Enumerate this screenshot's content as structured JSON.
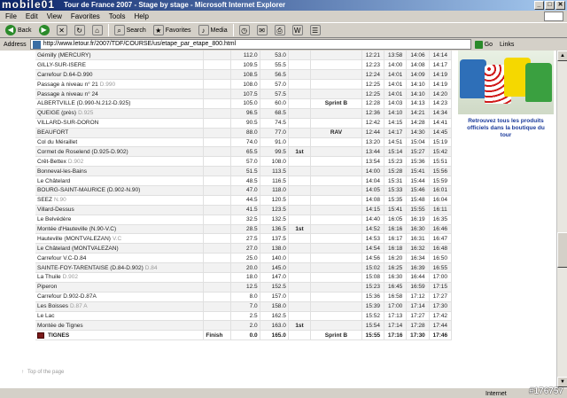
{
  "window": {
    "watermark": "mobile01",
    "title": "Tour de France 2007 - Stage by stage - Microsoft Internet Explorer",
    "min": "_",
    "max": "□",
    "close": "✕"
  },
  "menu": [
    "File",
    "Edit",
    "View",
    "Favorites",
    "Tools",
    "Help"
  ],
  "toolbar": {
    "back": "Back",
    "search": "Search",
    "favorites": "Favorites",
    "media": "Media"
  },
  "address": {
    "label": "Address",
    "url": "http://www.letour.fr/2007/TDF/COURSE/us/etape_par_etape_800.html",
    "go": "Go",
    "links": "Links"
  },
  "rows": [
    {
      "loc": "Gémilly (MERCURY)",
      "sub": "",
      "km1": "112.0",
      "km2": "53.0",
      "mark": "",
      "sprint": "",
      "t1": "12:21",
      "t2": "13:58",
      "t3": "14:06",
      "t4": "14:14"
    },
    {
      "loc": "GILLY-SUR-ISERE",
      "sub": "",
      "km1": "109.5",
      "km2": "55.5",
      "mark": "",
      "sprint": "",
      "t1": "12:23",
      "t2": "14:00",
      "t3": "14:08",
      "t4": "14:17"
    },
    {
      "loc": "Carrefour D.64-D.990",
      "sub": "",
      "km1": "108.5",
      "km2": "56.5",
      "mark": "",
      "sprint": "",
      "t1": "12:24",
      "t2": "14:01",
      "t3": "14:09",
      "t4": "14:19"
    },
    {
      "loc": "Passage à niveau n° 21",
      "sub": "D.990",
      "km1": "108.0",
      "km2": "57.0",
      "mark": "",
      "sprint": "",
      "t1": "12:25",
      "t2": "14:01",
      "t3": "14:10",
      "t4": "14:19"
    },
    {
      "loc": "Passage à niveau n° 24",
      "sub": "",
      "km1": "107.5",
      "km2": "57.5",
      "mark": "",
      "sprint": "",
      "t1": "12:25",
      "t2": "14:01",
      "t3": "14:10",
      "t4": "14:20"
    },
    {
      "loc": "ALBERTVILLE (D.990-N.212-D.925)",
      "sub": "",
      "km1": "105.0",
      "km2": "60.0",
      "mark": "",
      "sprint": "Sprint B",
      "t1": "12:28",
      "t2": "14:03",
      "t3": "14:13",
      "t4": "14:23"
    },
    {
      "loc": "QUEIGE (près)",
      "sub": "D.925",
      "km1": "96.5",
      "km2": "68.5",
      "mark": "",
      "sprint": "",
      "t1": "12:36",
      "t2": "14:10",
      "t3": "14:21",
      "t4": "14:34"
    },
    {
      "loc": "VILLARD-SUR-DORON",
      "sub": "",
      "km1": "90.5",
      "km2": "74.5",
      "mark": "",
      "sprint": "",
      "t1": "12:42",
      "t2": "14:15",
      "t3": "14:28",
      "t4": "14:41"
    },
    {
      "loc": "BEAUFORT",
      "sub": "",
      "km1": "88.0",
      "km2": "77.0",
      "mark": "",
      "sprint": "RAV",
      "t1": "12:44",
      "t2": "14:17",
      "t3": "14:30",
      "t4": "14:45"
    },
    {
      "loc": "Col du Méraillet",
      "sub": "",
      "km1": "74.0",
      "km2": "91.0",
      "mark": "",
      "sprint": "",
      "t1": "13:20",
      "t2": "14:51",
      "t3": "15:04",
      "t4": "15:19"
    },
    {
      "loc": "Cormet de Roselend (D.925-D.902)",
      "sub": "",
      "km1": "65.5",
      "km2": "99.5",
      "mark": "1st",
      "sprint": "",
      "t1": "13:44",
      "t2": "15:14",
      "t3": "15:27",
      "t4": "15:42"
    },
    {
      "loc": "Crêt-Bettex",
      "sub": "D.902",
      "km1": "57.0",
      "km2": "108.0",
      "mark": "",
      "sprint": "",
      "t1": "13:54",
      "t2": "15:23",
      "t3": "15:36",
      "t4": "15:51"
    },
    {
      "loc": "Bonneval-les-Bains",
      "sub": "",
      "km1": "51.5",
      "km2": "113.5",
      "mark": "",
      "sprint": "",
      "t1": "14:00",
      "t2": "15:28",
      "t3": "15:41",
      "t4": "15:56"
    },
    {
      "loc": "Le Châtelard",
      "sub": "",
      "km1": "48.5",
      "km2": "116.5",
      "mark": "",
      "sprint": "",
      "t1": "14:04",
      "t2": "15:31",
      "t3": "15:44",
      "t4": "15:59"
    },
    {
      "loc": "BOURG-SAINT-MAURICE (D.902-N.90)",
      "sub": "",
      "km1": "47.0",
      "km2": "118.0",
      "mark": "",
      "sprint": "",
      "t1": "14:05",
      "t2": "15:33",
      "t3": "15:46",
      "t4": "16:01"
    },
    {
      "loc": "SEEZ",
      "sub": "N.90",
      "km1": "44.5",
      "km2": "120.5",
      "mark": "",
      "sprint": "",
      "t1": "14:08",
      "t2": "15:35",
      "t3": "15:48",
      "t4": "16:04"
    },
    {
      "loc": "Villard-Dessus",
      "sub": "",
      "km1": "41.5",
      "km2": "123.5",
      "mark": "",
      "sprint": "",
      "t1": "14:15",
      "t2": "15:41",
      "t3": "15:55",
      "t4": "16:11"
    },
    {
      "loc": "Le Belvédère",
      "sub": "",
      "km1": "32.5",
      "km2": "132.5",
      "mark": "",
      "sprint": "",
      "t1": "14:40",
      "t2": "16:05",
      "t3": "16:19",
      "t4": "16:35"
    },
    {
      "loc": "Montée d'Hauteville (N.90-V.C)",
      "sub": "",
      "km1": "28.5",
      "km2": "136.5",
      "mark": "1st",
      "sprint": "",
      "t1": "14:52",
      "t2": "16:16",
      "t3": "16:30",
      "t4": "16:46"
    },
    {
      "loc": "Hauteville (MONTVALEZAN)",
      "sub": "V.C",
      "km1": "27.5",
      "km2": "137.5",
      "mark": "",
      "sprint": "",
      "t1": "14:53",
      "t2": "16:17",
      "t3": "16:31",
      "t4": "16:47"
    },
    {
      "loc": "Le Châtelard (MONTVALEZAN)",
      "sub": "",
      "km1": "27.0",
      "km2": "138.0",
      "mark": "",
      "sprint": "",
      "t1": "14:54",
      "t2": "16:18",
      "t3": "16:32",
      "t4": "16:48"
    },
    {
      "loc": "Carrefour V.C-D.84",
      "sub": "",
      "km1": "25.0",
      "km2": "140.0",
      "mark": "",
      "sprint": "",
      "t1": "14:56",
      "t2": "16:20",
      "t3": "16:34",
      "t4": "16:50"
    },
    {
      "loc": "SAINTE-FOY-TARENTAISE (D.84-D.902)",
      "sub": "D.84",
      "km1": "20.0",
      "km2": "145.0",
      "mark": "",
      "sprint": "",
      "t1": "15:02",
      "t2": "16:25",
      "t3": "16:39",
      "t4": "16:55"
    },
    {
      "loc": "La Thuile",
      "sub": "D.902",
      "km1": "18.0",
      "km2": "147.0",
      "mark": "",
      "sprint": "",
      "t1": "15:08",
      "t2": "16:30",
      "t3": "16:44",
      "t4": "17:00"
    },
    {
      "loc": "Piperon",
      "sub": "",
      "km1": "12.5",
      "km2": "152.5",
      "mark": "",
      "sprint": "",
      "t1": "15:23",
      "t2": "16:45",
      "t3": "16:59",
      "t4": "17:15"
    },
    {
      "loc": "Carrefour D.902-D.87A",
      "sub": "",
      "km1": "8.0",
      "km2": "157.0",
      "mark": "",
      "sprint": "",
      "t1": "15:36",
      "t2": "16:58",
      "t3": "17:12",
      "t4": "17:27"
    },
    {
      "loc": "Les Boisses",
      "sub": "D.87 A",
      "km1": "7.0",
      "km2": "158.0",
      "mark": "",
      "sprint": "",
      "t1": "15:39",
      "t2": "17:00",
      "t3": "17:14",
      "t4": "17:30"
    },
    {
      "loc": "Le Lac",
      "sub": "",
      "km1": "2.5",
      "km2": "162.5",
      "mark": "",
      "sprint": "",
      "t1": "15:52",
      "t2": "17:13",
      "t3": "17:27",
      "t4": "17:42"
    },
    {
      "loc": "Montée de Tignes",
      "sub": "",
      "km1": "2.0",
      "km2": "163.0",
      "mark": "1st",
      "sprint": "",
      "t1": "15:54",
      "t2": "17:14",
      "t3": "17:28",
      "t4": "17:44"
    }
  ],
  "finish": {
    "loc": "TIGNES",
    "label": "Finish",
    "km1": "0.0",
    "km2": "165.0",
    "sprint": "Sprint B",
    "t1": "15:55",
    "t2": "17:16",
    "t3": "17:30",
    "t4": "17:46"
  },
  "ad": {
    "text": "Retrouvez tous les produits officiels dans la boutique du tour"
  },
  "page": {
    "top_link": "Top of the page"
  },
  "status": {
    "zone": "Internet",
    "watermark": "#176757"
  },
  "colors": {
    "titlebar": "#0a246a",
    "sprint": "#2a8a2a",
    "mountain": "#b00000",
    "rav": "#1a3a9a"
  }
}
